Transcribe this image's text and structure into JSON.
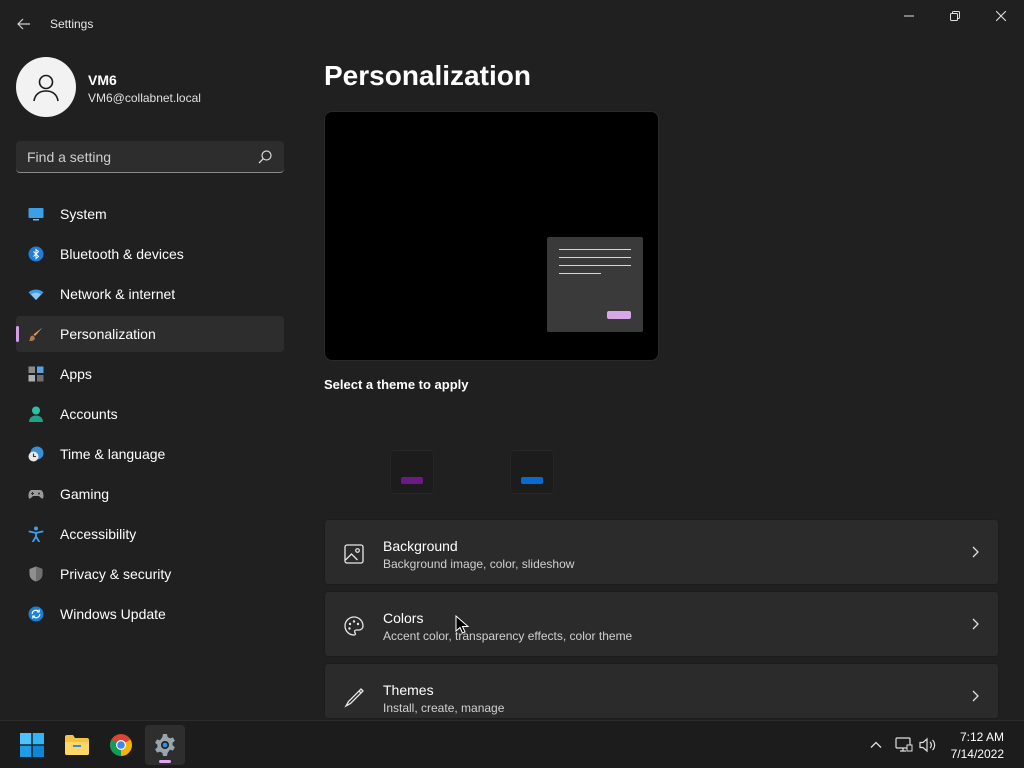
{
  "window": {
    "title": "Settings"
  },
  "colors": {
    "accent": "#d59de8",
    "background": "#202020",
    "card": "#2b2b2b"
  },
  "profile": {
    "name": "VM6",
    "email": "VM6@collabnet.local"
  },
  "search": {
    "placeholder": "Find a setting"
  },
  "sidebar": {
    "items": [
      {
        "label": "System",
        "icon": "system-icon",
        "selected": false
      },
      {
        "label": "Bluetooth & devices",
        "icon": "bluetooth-icon",
        "selected": false
      },
      {
        "label": "Network & internet",
        "icon": "wifi-icon",
        "selected": false
      },
      {
        "label": "Personalization",
        "icon": "brush-icon",
        "selected": true
      },
      {
        "label": "Apps",
        "icon": "apps-icon",
        "selected": false
      },
      {
        "label": "Accounts",
        "icon": "accounts-icon",
        "selected": false
      },
      {
        "label": "Time & language",
        "icon": "clock-globe-icon",
        "selected": false
      },
      {
        "label": "Gaming",
        "icon": "gamepad-icon",
        "selected": false
      },
      {
        "label": "Accessibility",
        "icon": "accessibility-icon",
        "selected": false
      },
      {
        "label": "Privacy & security",
        "icon": "shield-icon",
        "selected": false
      },
      {
        "label": "Windows Update",
        "icon": "update-icon",
        "selected": false
      }
    ]
  },
  "main": {
    "title": "Personalization",
    "select_theme_label": "Select a theme to apply",
    "themes": [
      {
        "swatch_color": "#6b1a86"
      },
      {
        "swatch_color": "#0a6ad0"
      }
    ],
    "cards": [
      {
        "title": "Background",
        "subtitle": "Background image, color, slideshow",
        "icon": "image-icon"
      },
      {
        "title": "Colors",
        "subtitle": "Accent color, transparency effects, color theme",
        "icon": "palette-icon"
      },
      {
        "title": "Themes",
        "subtitle": "Install, create, manage",
        "icon": "pen-icon"
      }
    ]
  },
  "taskbar": {
    "apps": [
      "start-icon",
      "file-explorer-icon",
      "chrome-icon",
      "settings-icon"
    ],
    "clock": {
      "time": "7:12 AM",
      "date": "7/14/2022"
    }
  }
}
